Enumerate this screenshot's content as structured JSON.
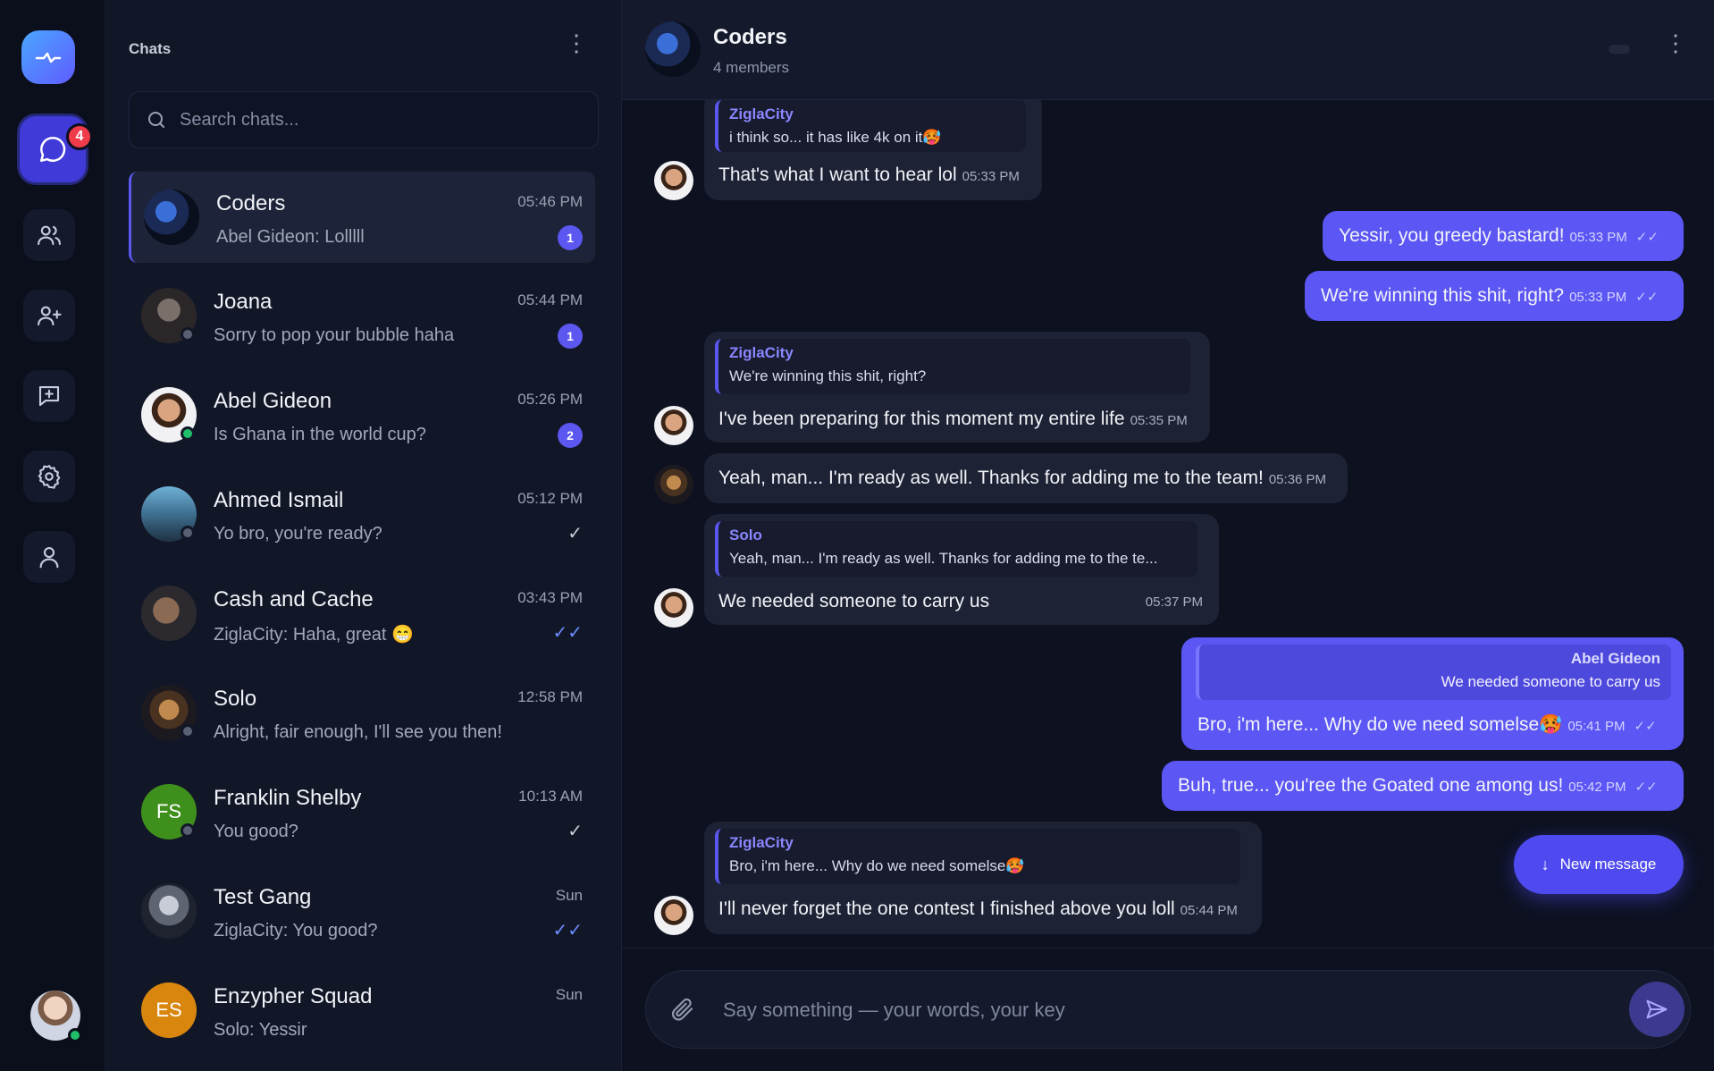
{
  "colors": {
    "accent": "#5b57f0",
    "outgoing_bubble": "#5b56f4",
    "incoming_bubble": "#1d2235",
    "unread_badge": "#ef3b4a",
    "online": "#20c06b"
  },
  "rail": {
    "badge_count": "4",
    "items": [
      {
        "icon": "chat-bubble-icon",
        "active": true
      },
      {
        "icon": "users-icon"
      },
      {
        "icon": "add-user-icon"
      },
      {
        "icon": "new-message-icon"
      },
      {
        "icon": "gear-icon"
      },
      {
        "icon": "user-icon"
      }
    ]
  },
  "sidebar": {
    "title": "Chats",
    "search_placeholder": "Search chats...",
    "chats": [
      {
        "name": "Coders",
        "time": "05:46 PM",
        "preview": "Abel Gideon: Lolllll",
        "unread": "1",
        "selected": true
      },
      {
        "name": "Joana",
        "time": "05:44 PM",
        "preview": "Sorry to pop your bubble haha",
        "unread": "1"
      },
      {
        "name": "Abel Gideon",
        "time": "05:26 PM",
        "preview": "Is Ghana in the world cup?",
        "unread": "2",
        "status": "online"
      },
      {
        "name": "Ahmed Ismail",
        "time": "05:12 PM",
        "preview": "Yo bro, you're ready?",
        "tick": "✓"
      },
      {
        "name": "Cash and Cache",
        "time": "03:43 PM",
        "preview": "ZiglaCity: Haha, great 😁",
        "tick": "✓✓"
      },
      {
        "name": "Solo",
        "time": "12:58 PM",
        "preview": "Alright, fair enough, I'll see you then!"
      },
      {
        "name": "Franklin Shelby",
        "time": "10:13 AM",
        "preview": "You good?",
        "initials": "FS",
        "tick": "✓"
      },
      {
        "name": "Test Gang",
        "time": "Sun",
        "preview": "ZiglaCity: You good?",
        "tick": "✓✓"
      },
      {
        "name": "Enzypher Squad",
        "time": "Sun",
        "preview": "Solo: Yessir",
        "initials": "ES"
      }
    ]
  },
  "header": {
    "name": "Coders",
    "members": "4 members"
  },
  "messages": [
    {
      "dir": "in",
      "quote_name": "ZiglaCity",
      "quote_text": "i think so... it has like 4k on it🥵",
      "text": "That's what I want to hear lol",
      "time": "05:33 PM"
    },
    {
      "dir": "out",
      "text": "Yessir, you greedy bastard!",
      "time": "05:33 PM",
      "check": "✓✓"
    },
    {
      "dir": "out",
      "text": "We're winning this shit, right?",
      "time": "05:33 PM",
      "check": "✓✓"
    },
    {
      "dir": "in",
      "quote_name": "ZiglaCity",
      "quote_text": "We're winning this shit, right?",
      "text": "I've been preparing for this moment my entire life",
      "time": "05:35 PM"
    },
    {
      "dir": "in",
      "text": "Yeah, man... I'm ready as well. Thanks for adding me to the team!",
      "time": "05:36 PM"
    },
    {
      "dir": "in",
      "quote_name": "Solo",
      "quote_text": "Yeah, man... I'm ready as well. Thanks for adding me to the te...",
      "text": "We needed someone to carry us",
      "time": "05:37 PM"
    },
    {
      "dir": "out",
      "quote_name": "Abel Gideon",
      "quote_text": "We needed someone to carry us",
      "text": "Bro, i'm here... Why do we need somelse🥵",
      "time": "05:41 PM",
      "check": "✓✓"
    },
    {
      "dir": "out",
      "text": "Buh, true... you'ree the Goated one among us!",
      "time": "05:42 PM",
      "check": "✓✓"
    },
    {
      "dir": "in",
      "quote_name": "ZiglaCity",
      "quote_text": "Bro, i'm here... Why do we need somelse🥵",
      "text": "I'll never forget the one contest I finished above you loll",
      "time": "05:44 PM"
    }
  ],
  "new_message_button": "New message",
  "composer": {
    "placeholder": "Say something — your words, your key"
  }
}
